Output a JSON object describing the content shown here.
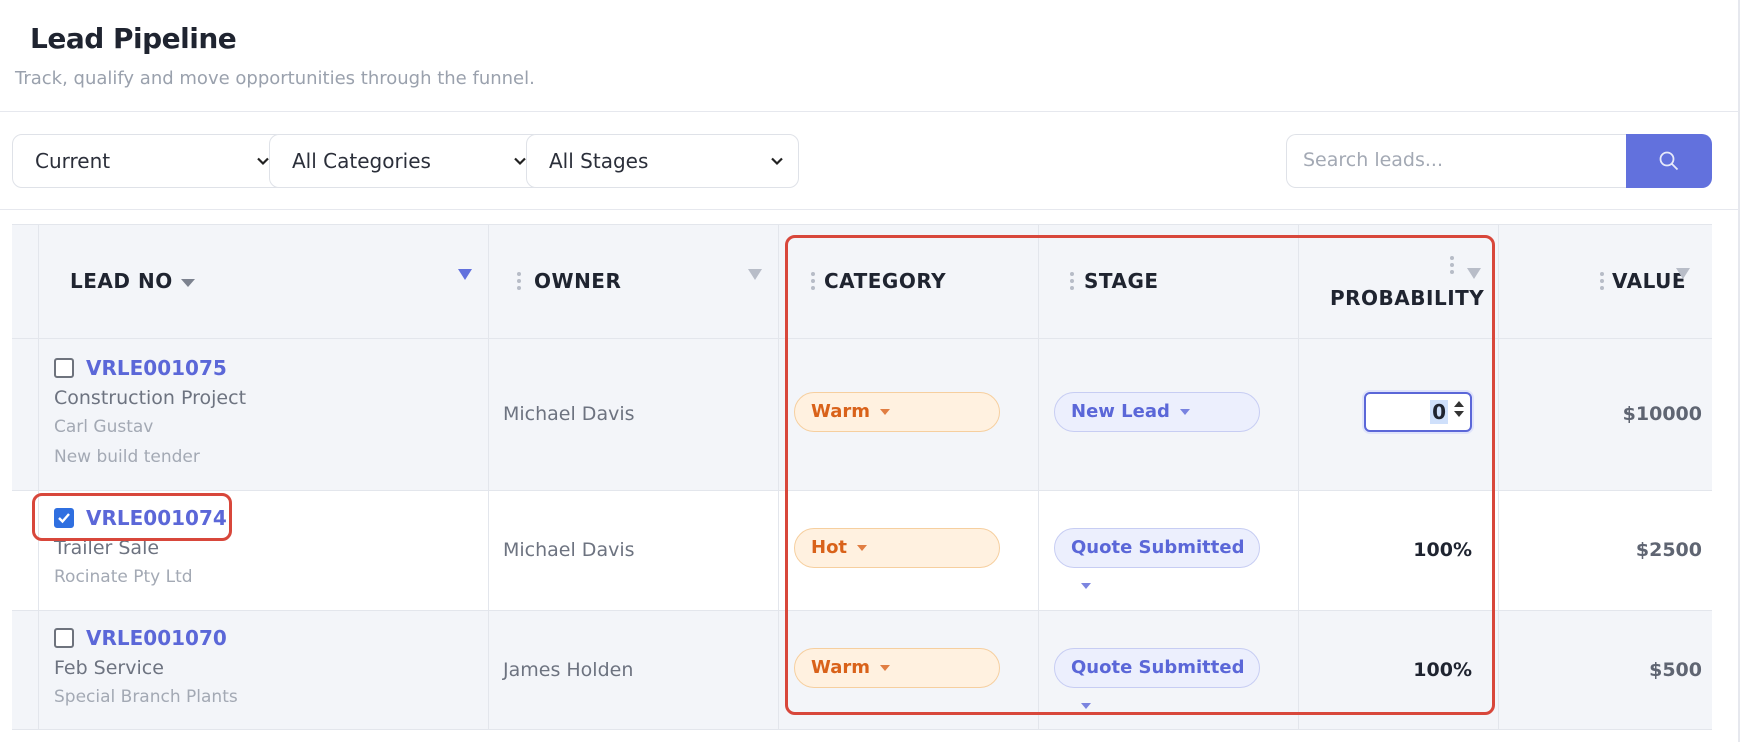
{
  "page": {
    "title": "Lead Pipeline",
    "subtitle": "Track, qualify and move opportunities through the funnel."
  },
  "filters": {
    "period": "Current",
    "category": "All Categories",
    "stage": "All Stages",
    "search_placeholder": "Search leads..."
  },
  "columns": {
    "lead_no": "LEAD NO",
    "owner": "OWNER",
    "category": "CATEGORY",
    "stage": "STAGE",
    "probability": "PROBABILITY",
    "value": "VALUE"
  },
  "rows": [
    {
      "checked": false,
      "lead_no": "VRLE001075",
      "title": "Construction Project",
      "contact": "Carl Gustav",
      "note": "New build tender",
      "owner": "Michael Davis",
      "category": "Warm",
      "stage": "New Lead",
      "probability": "0",
      "value": "$10000"
    },
    {
      "checked": true,
      "lead_no": "VRLE001074",
      "title": "Trailer Sale",
      "contact": "Rocinate Pty Ltd",
      "owner": "Michael Davis",
      "category": "Hot",
      "stage": "Quote Submitted",
      "probability": "100%",
      "value": "$2500"
    },
    {
      "checked": false,
      "lead_no": "VRLE001070",
      "title": "Feb Service",
      "contact": "Special Branch Plants",
      "owner": "James Holden",
      "category": "Warm",
      "stage": "Quote Submitted",
      "probability": "100%",
      "value": "$500"
    }
  ],
  "colors": {
    "accent": "#5b67d8",
    "search_button": "#6271dd",
    "category_pill": "#fff1e0",
    "stage_pill": "#eceffd",
    "highlight": "#d8473b"
  },
  "icons": {
    "search": "search-icon",
    "filter": "funnel-icon",
    "column_grip": "drag-handle-icon",
    "dropdown": "chevron-down-icon"
  }
}
